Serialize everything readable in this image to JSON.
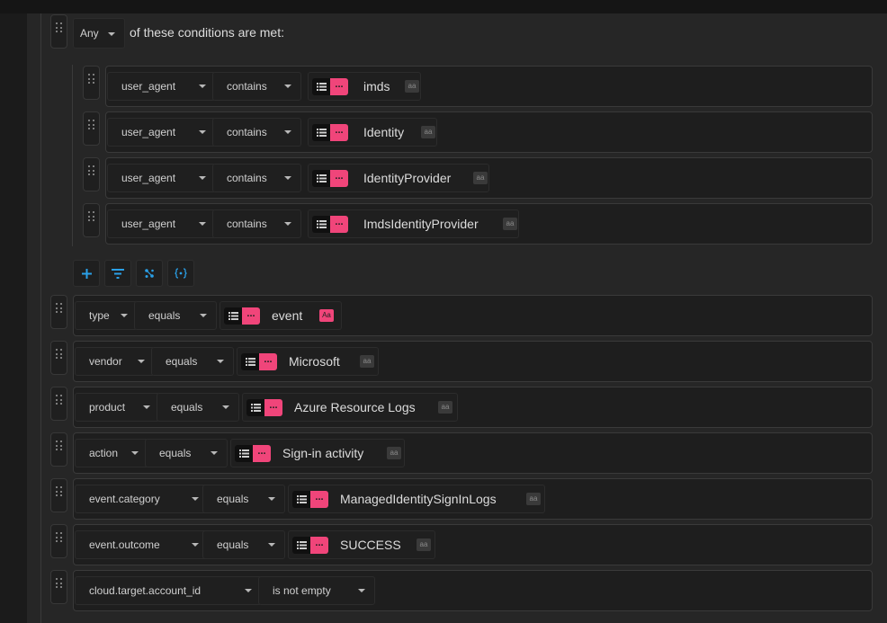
{
  "group": {
    "match_mode": "Any",
    "suffix_text": "of these conditions are met:"
  },
  "nested_conditions": [
    {
      "field": "user_agent",
      "operator": "contains",
      "value": "imds",
      "case_label": "aa"
    },
    {
      "field": "user_agent",
      "operator": "contains",
      "value": "Identity",
      "case_label": "aa"
    },
    {
      "field": "user_agent",
      "operator": "contains",
      "value": "IdentityProvider",
      "case_label": "aa"
    },
    {
      "field": "user_agent",
      "operator": "contains",
      "value": "ImdsIdentityProvider",
      "case_label": "aa"
    }
  ],
  "toolbar": {
    "icons": [
      "plus-icon",
      "filter-icon",
      "nodes-icon",
      "variable-icon"
    ]
  },
  "conditions": [
    {
      "field": "type",
      "operator": "equals",
      "value": "event",
      "case_label": "Aa",
      "case_sensitive": true
    },
    {
      "field": "vendor",
      "operator": "equals",
      "value": "Microsoft",
      "case_label": "aa"
    },
    {
      "field": "product",
      "operator": "equals",
      "value": "Azure Resource Logs",
      "case_label": "aa"
    },
    {
      "field": "action",
      "operator": "equals",
      "value": "Sign-in activity",
      "case_label": "aa"
    },
    {
      "field": "event.category",
      "operator": "equals",
      "value": "ManagedIdentitySignInLogs",
      "case_label": "aa"
    },
    {
      "field": "event.outcome",
      "operator": "equals",
      "value": "SUCCESS",
      "case_label": "aa"
    },
    {
      "field": "cloud.target.account_id",
      "operator": "is not empty"
    }
  ],
  "toggle_label": "...",
  "colors": {
    "accent": "#f0457a",
    "link_blue": "#2aa0e8",
    "background": "#1e1e1e"
  }
}
